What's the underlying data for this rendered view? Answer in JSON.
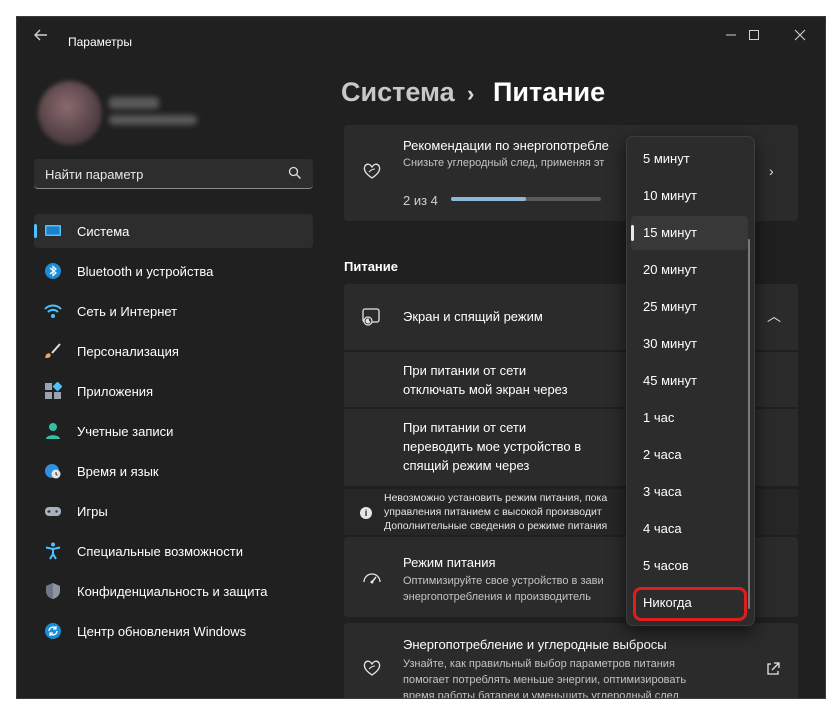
{
  "window": {
    "title": "Параметры",
    "controls": {
      "minimize": "—",
      "maximize": "☐",
      "close": "✕"
    }
  },
  "search": {
    "placeholder": "Найти параметр"
  },
  "sidebar": {
    "items": [
      {
        "label": "Система",
        "icon": "monitor-icon",
        "active": true
      },
      {
        "label": "Bluetooth и устройства",
        "icon": "bluetooth-icon"
      },
      {
        "label": "Сеть и Интернет",
        "icon": "wifi-icon"
      },
      {
        "label": "Персонализация",
        "icon": "brush-icon"
      },
      {
        "label": "Приложения",
        "icon": "apps-icon"
      },
      {
        "label": "Учетные записи",
        "icon": "person-icon"
      },
      {
        "label": "Время и язык",
        "icon": "globe-clock-icon"
      },
      {
        "label": "Игры",
        "icon": "gamepad-icon"
      },
      {
        "label": "Специальные возможности",
        "icon": "accessibility-icon"
      },
      {
        "label": "Конфиденциальность и защита",
        "icon": "shield-icon"
      },
      {
        "label": "Центр обновления Windows",
        "icon": "update-icon"
      }
    ]
  },
  "breadcrumb": {
    "section": "Система",
    "separator": "›",
    "page": "Питание"
  },
  "recommendations": {
    "title": "Рекомендации по энергопотребле",
    "subtitle": "Снизьте углеродный след, применяя эт",
    "progress_text": "2 из 4",
    "progress_fraction": 0.5
  },
  "power_section_label": "Питание",
  "screen_sleep": {
    "title": "Экран и спящий режим",
    "rows": [
      {
        "line1": "При питании от сети",
        "line2": "отключать мой экран через"
      },
      {
        "line1": "При питании от сети",
        "line2": "переводить мое устройство в",
        "line3": "спящий режим через"
      }
    ]
  },
  "notice": {
    "line1": "Невозможно установить режим питания, пока",
    "line2": "управления питанием с высокой производит",
    "line3": "Дополнительные сведения о режиме питания"
  },
  "power_mode": {
    "title": "Режим питания",
    "line1": "Оптимизируйте свое устройство в зави",
    "line2": "энергопотребления и производитель"
  },
  "energy": {
    "title": "Энергопотребление и углеродные выбросы",
    "line1": "Узнайте, как правильный выбор параметров питания",
    "line2": "помогает потреблять меньше энергии, оптимизировать",
    "line3": "время работы батареи и уменьшить углеродный след"
  },
  "dropdown": {
    "options": [
      "5 минут",
      "10 минут",
      "15 минут",
      "20 минут",
      "25 минут",
      "30 минут",
      "45 минут",
      "1 час",
      "2 часа",
      "3 часа",
      "4 часа",
      "5 часов",
      "Никогда"
    ],
    "selected": "15 минут",
    "highlighted": "Никогда"
  },
  "colors": {
    "accent": "#4cc2ff",
    "highlight": "#e01d1d",
    "background": "#202020",
    "card": "#2b2b2b"
  }
}
